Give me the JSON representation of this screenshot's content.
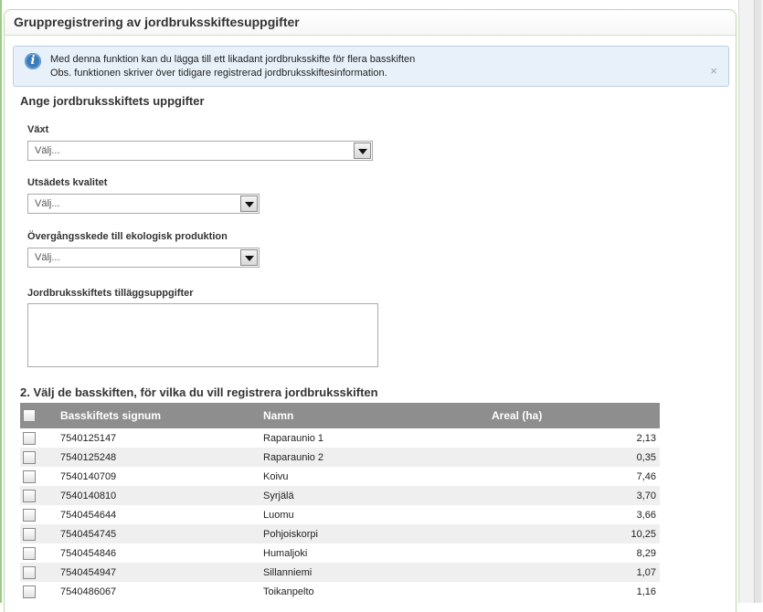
{
  "panel": {
    "title": "Gruppregistrering av jordbruksskiftesuppgifter"
  },
  "info": {
    "line1": "Med denna funktion kan du lägga till ett likadant jordbruksskifte för flera basskiften",
    "line2": "Obs. funktionen skriver över tidigare registrerad jordbruksskiftesinformation.",
    "close": "×",
    "icon": "i"
  },
  "form": {
    "title": "Ange jordbruksskiftets uppgifter",
    "crop_label": "Växt",
    "crop_value": "Välj...",
    "seed_label": "Utsädets kvalitet",
    "seed_value": "Välj...",
    "organic_label": "Övergångsskede till ekologisk produktion",
    "organic_value": "Välj...",
    "extra_label": "Jordbruksskiftets tilläggsuppgifter",
    "extra_value": ""
  },
  "table": {
    "title": "2. Välj de basskiften, för vilka du vill registrera jordbruksskiften",
    "headers": {
      "id": "Basskiftets signum",
      "name": "Namn",
      "area": "Areal (ha)"
    },
    "rows": [
      {
        "id": "7540125147",
        "name": "Raparaunio 1",
        "area": "2,13"
      },
      {
        "id": "7540125248",
        "name": "Raparaunio 2",
        "area": "0,35"
      },
      {
        "id": "7540140709",
        "name": "Koivu",
        "area": "7,46"
      },
      {
        "id": "7540140810",
        "name": "Syrjälä",
        "area": "3,70"
      },
      {
        "id": "7540454644",
        "name": "Luomu",
        "area": "3,66"
      },
      {
        "id": "7540454745",
        "name": "Pohjoiskorpi",
        "area": "10,25"
      },
      {
        "id": "7540454846",
        "name": "Humaljoki",
        "area": "8,29"
      },
      {
        "id": "7540454947",
        "name": "Sillanniemi",
        "area": "1,07"
      },
      {
        "id": "7540486067",
        "name": "Toikanpelto",
        "area": "1,16"
      }
    ]
  }
}
